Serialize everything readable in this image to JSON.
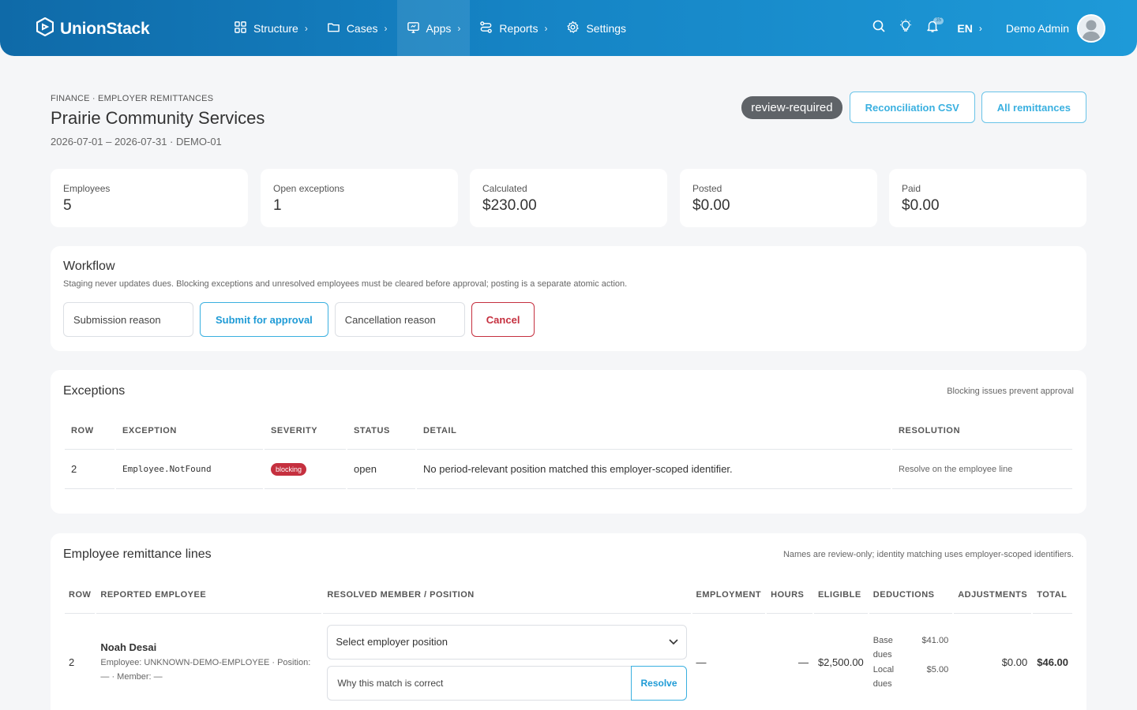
{
  "app": {
    "brand": "UnionStack"
  },
  "nav": [
    {
      "label": "Structure",
      "icon": "grid-icon"
    },
    {
      "label": "Cases",
      "icon": "folder-icon"
    },
    {
      "label": "Apps",
      "icon": "monitor-icon"
    },
    {
      "label": "Reports",
      "icon": "route-icon"
    },
    {
      "label": "Settings",
      "icon": "gear-icon"
    }
  ],
  "header_right": {
    "language": "EN",
    "user_name": "Demo Admin",
    "notification_count": "35"
  },
  "page": {
    "breadcrumb": "Finance · Employer remittances",
    "title": "Prairie Community Services",
    "period": "2026-07-01 – 2026-07-31 · DEMO-01",
    "status": "review-required",
    "actions": {
      "csv": "Reconciliation CSV",
      "all": "All remittances"
    }
  },
  "stats": [
    {
      "label": "Employees",
      "value": "5"
    },
    {
      "label": "Open exceptions",
      "value": "1"
    },
    {
      "label": "Calculated",
      "value": "$230.00"
    },
    {
      "label": "Posted",
      "value": "$0.00"
    },
    {
      "label": "Paid",
      "value": "$0.00"
    }
  ],
  "workflow": {
    "title": "Workflow",
    "description": "Staging never updates dues. Blocking exceptions and unresolved employees must be cleared before approval; posting is a separate atomic action.",
    "submission_placeholder": "Submission reason",
    "submit_label": "Submit for approval",
    "cancellation_placeholder": "Cancellation reason",
    "cancel_label": "Cancel"
  },
  "exceptions": {
    "title": "Exceptions",
    "note": "Blocking issues prevent approval",
    "headers": [
      "Row",
      "Exception",
      "Severity",
      "Status",
      "Detail",
      "Resolution"
    ],
    "rows": [
      {
        "row": "2",
        "exception": "Employee.NotFound",
        "severity": "blocking",
        "status": "open",
        "detail": "No period-relevant position matched this employer-scoped identifier.",
        "resolution": "Resolve on the employee line"
      }
    ]
  },
  "lines": {
    "title": "Employee remittance lines",
    "note": "Names are review-only; identity matching uses employer-scoped identifiers.",
    "headers": [
      "Row",
      "Reported employee",
      "Resolved member / position",
      "Employment",
      "Hours",
      "Eligible",
      "Deductions",
      "Adjustments",
      "Total"
    ],
    "rows": [
      {
        "row": "2",
        "name": "Noah Desai",
        "meta1": "Employee: UNKNOWN-DEMO-EMPLOYEE · Position:",
        "meta2": "— · Member: —",
        "select_label": "Select employer position",
        "why_placeholder": "Why this match is correct",
        "resolve_label": "Resolve",
        "employment": "—",
        "hours": "—",
        "eligible": "$2,500.00",
        "deductions": [
          {
            "name1": "Base",
            "name2": "dues",
            "amount": "$41.00"
          },
          {
            "name1": "Local",
            "name2": "dues",
            "amount": "$5.00"
          }
        ],
        "adjustments": "$0.00",
        "total": "$46.00"
      }
    ]
  }
}
